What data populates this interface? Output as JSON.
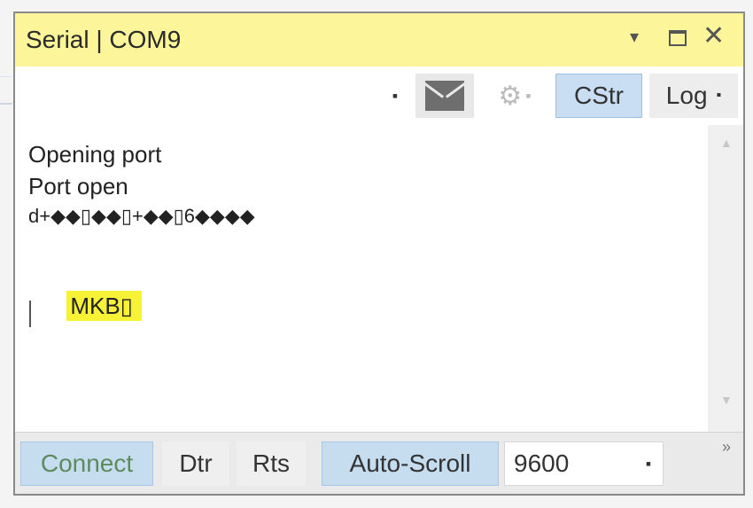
{
  "window": {
    "title": "Serial | COM9",
    "pin_glyph": "▾",
    "close_glyph": "✕"
  },
  "toolbar": {
    "dropdown_glyph": "▪",
    "gear_glyph": "⚙",
    "gear_dropdown_glyph": "▪",
    "cstr_label": "CStr",
    "log_label": "Log",
    "log_dropdown_glyph": "▪"
  },
  "terminal": {
    "lines": [
      "Opening port",
      "Port open",
      "d+◆◆▯◆◆▯+◆◆▯6◆◆◆◆",
      "MKB▯"
    ]
  },
  "scrollbar": {
    "up_glyph": "▲",
    "down_glyph": "▼"
  },
  "statusbar": {
    "connect_label": "Connect",
    "dtr_label": "Dtr",
    "rts_label": "Rts",
    "autoscroll_label": "Auto-Scroll",
    "baud_value": "9600",
    "baud_dropdown_glyph": "▪",
    "more_glyph": "»"
  },
  "colors": {
    "titlebar": "#fcf59a",
    "highlight": "#f7f236",
    "active_button": "#c6dcef"
  }
}
